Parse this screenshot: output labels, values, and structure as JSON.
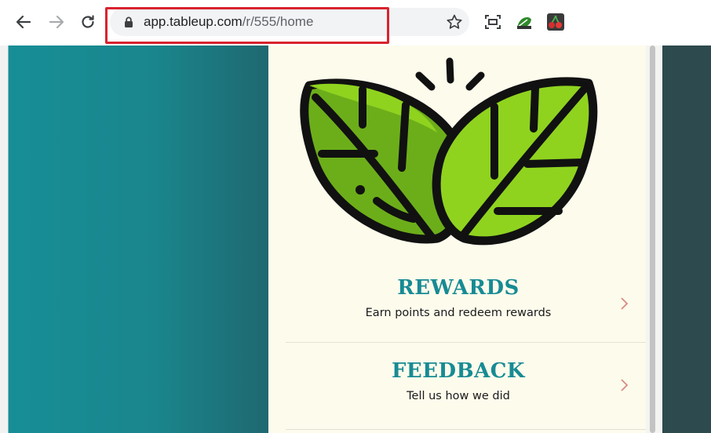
{
  "browser": {
    "url_host": "app.tableup.com",
    "url_path": "/r/555/home",
    "icons": [
      "back-icon",
      "forward-icon",
      "reload-icon",
      "lock-icon",
      "bookmark-star-icon",
      "screenshot-icon",
      "extension-icon",
      "cherry-extension-icon"
    ]
  },
  "colors": {
    "accent": "#178b94",
    "panel_bg": "#fdfbec",
    "leaf_light": "#8fd31f",
    "leaf_dark": "#6cae1a",
    "highlight": "#d9232e"
  },
  "menu": {
    "rewards": {
      "title": "REWARDS",
      "subtitle": "Earn points and redeem rewards"
    },
    "feedback": {
      "title": "FEEDBACK",
      "subtitle": "Tell us how we did"
    }
  }
}
